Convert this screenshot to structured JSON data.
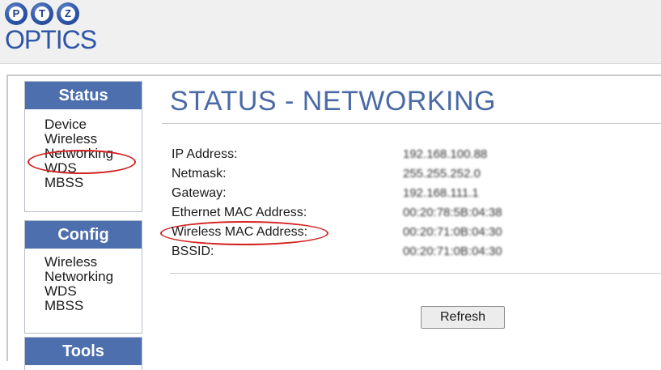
{
  "header": {
    "logo_letters": [
      "P",
      "T",
      "Z"
    ],
    "logo_word": "OPTICS"
  },
  "sidebar": {
    "status": {
      "heading": "Status",
      "items": [
        "Device",
        "Wireless",
        "Networking",
        "WDS",
        "MBSS"
      ]
    },
    "config": {
      "heading": "Config",
      "items": [
        "Wireless",
        "Networking",
        "WDS",
        "MBSS"
      ]
    },
    "tools": {
      "heading": "Tools"
    }
  },
  "main": {
    "title": "STATUS - NETWORKING",
    "fields": [
      {
        "label": "IP Address:",
        "value": "192.168.100.88"
      },
      {
        "label": "Netmask:",
        "value": "255.255.252.0"
      },
      {
        "label": "Gateway:",
        "value": "192.168.111.1"
      },
      {
        "label": "Ethernet MAC Address:",
        "value": "00:20:78:5B:04:38"
      },
      {
        "label": "Wireless MAC Address:",
        "value": "00:20:71:0B:04:30"
      },
      {
        "label": "BSSID:",
        "value": "00:20:71:0B:04:30"
      }
    ],
    "refresh_label": "Refresh"
  },
  "annotations": {
    "highlight_color": "#d42020"
  },
  "colors": {
    "menu_header": "#4d6fae",
    "title": "#4a6aa6",
    "logo": "#2e55a8"
  }
}
